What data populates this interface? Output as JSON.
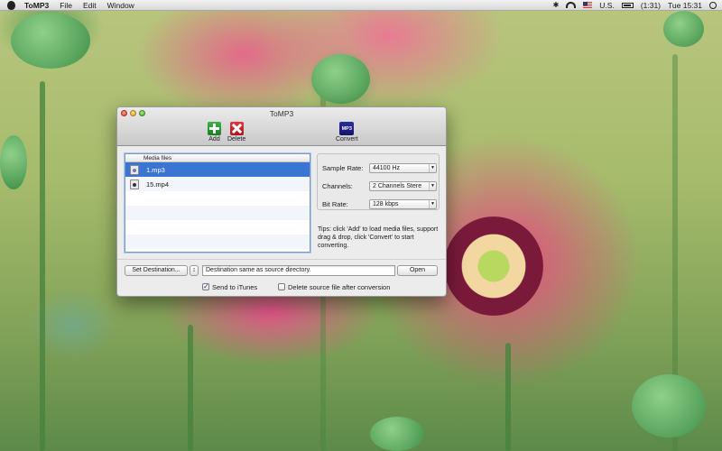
{
  "menubar": {
    "app_name": "ToMP3",
    "menus": [
      "File",
      "Edit",
      "Window"
    ],
    "input_source": "U.S.",
    "battery_time": "(1:31)",
    "clock": "Tue 15:31"
  },
  "window": {
    "title": "ToMP3",
    "toolbar": {
      "add_label": "Add",
      "delete_label": "Delete",
      "convert_label": "Convert",
      "convert_icon_text": "MP3"
    },
    "media_list": {
      "header": "Media files",
      "files": [
        {
          "name": "1.mp3",
          "selected": true
        },
        {
          "name": "15.mp4",
          "selected": false
        }
      ]
    },
    "settings": {
      "sample_rate_label": "Sample Rate:",
      "sample_rate_value": "44100 Hz",
      "channels_label": "Channels:",
      "channels_value": "2 Channels Stere",
      "bit_rate_label": "Bit Rate:",
      "bit_rate_value": "128 kbps"
    },
    "tips": "Tips: click 'Add' to load media files, support drag & drop, click 'Convert' to start converting.",
    "destination": {
      "set_button": "Set Destination...",
      "path": "Destination same as source directory.",
      "open_button": "Open"
    },
    "options": {
      "send_to_itunes_label": "Send to iTunes",
      "send_to_itunes_checked": true,
      "delete_source_label": "Delete source file after conversion",
      "delete_source_checked": false
    }
  }
}
